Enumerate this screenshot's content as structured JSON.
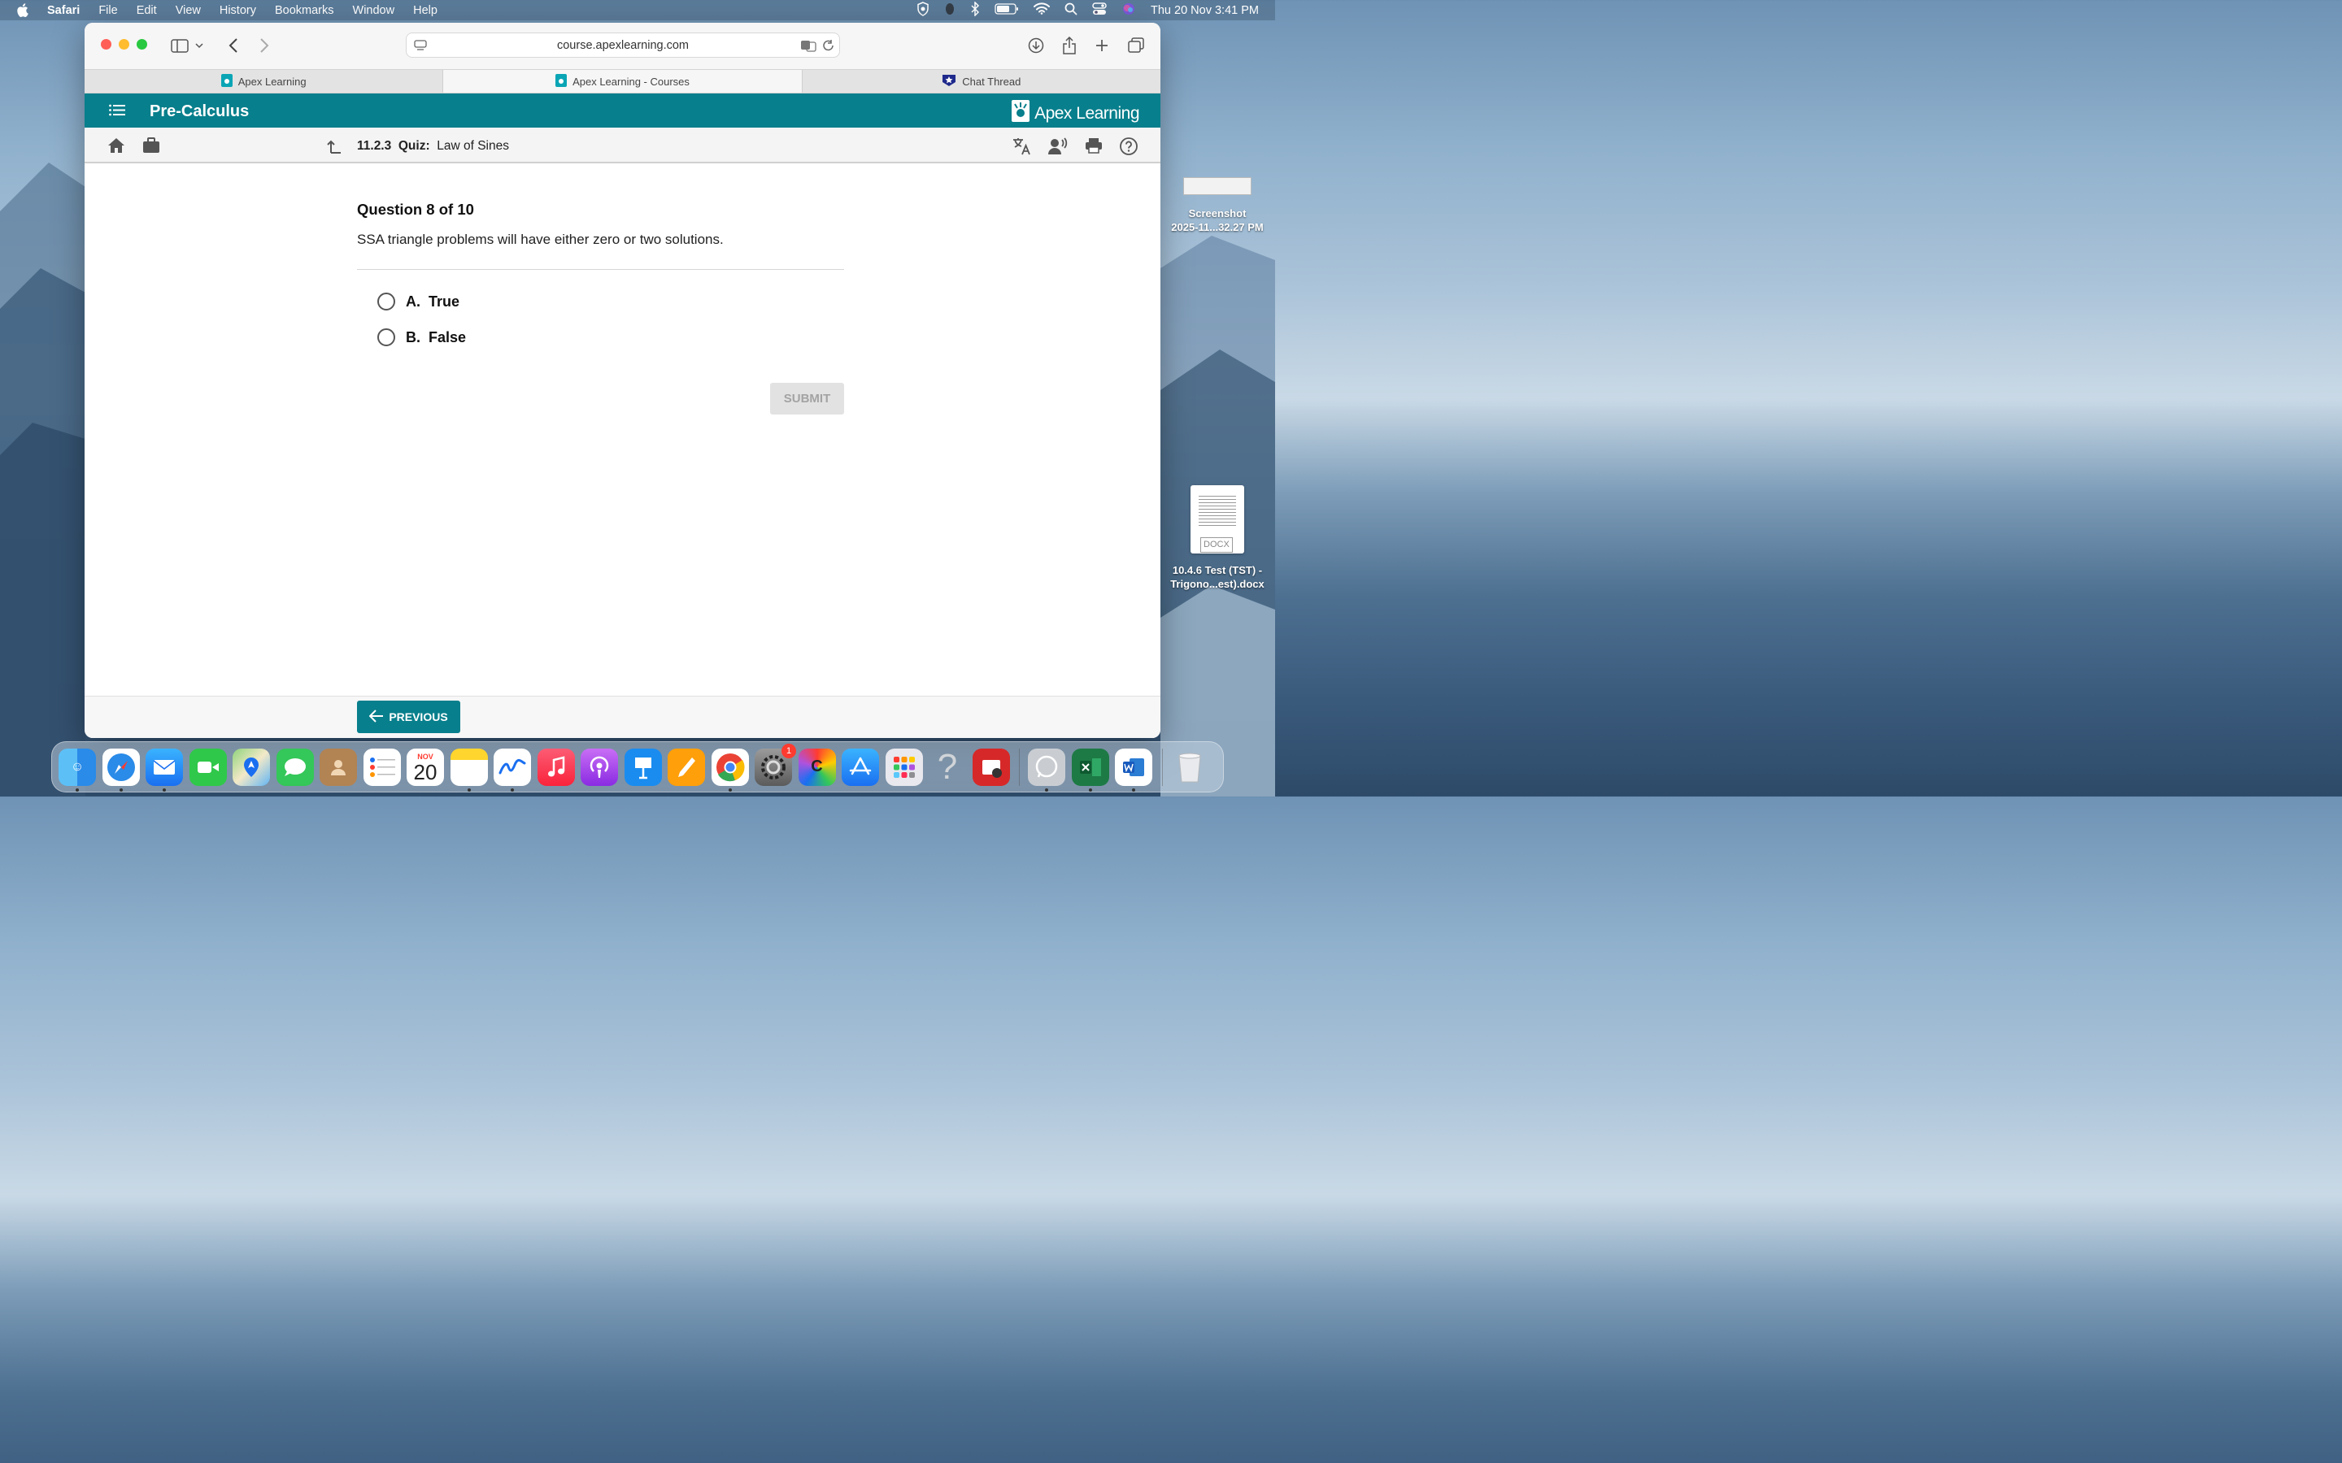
{
  "menubar": {
    "app": "Safari",
    "items": [
      "File",
      "Edit",
      "View",
      "History",
      "Bookmarks",
      "Window",
      "Help"
    ],
    "clock": "Thu 20 Nov  3:41 PM"
  },
  "browser": {
    "url": "course.apexlearning.com",
    "tabs": [
      {
        "label": "Apex Learning",
        "active": false
      },
      {
        "label": "Apex Learning - Courses",
        "active": true
      },
      {
        "label": "Chat Thread",
        "active": false
      }
    ]
  },
  "apex": {
    "course_title": "Pre-Calculus",
    "logo_text": "Apex Learning",
    "breadcrumb": {
      "number": "11.2.3",
      "type": "Quiz:",
      "name": "Law of Sines"
    }
  },
  "question": {
    "heading": "Question 8 of 10",
    "text": "SSA triangle problems will have either zero or two solutions.",
    "options": [
      {
        "letter": "A.",
        "label": "True"
      },
      {
        "letter": "B.",
        "label": "False"
      }
    ],
    "submit_label": "SUBMIT",
    "previous_label": "PREVIOUS"
  },
  "desktop": {
    "files": [
      {
        "name_line1": "Screenshot",
        "name_line2": "2025-11...32.27 PM"
      },
      {
        "name_line1": "10.4.6 Test (TST) -",
        "name_line2": "Trigono...est).docx",
        "badge": "DOCX"
      }
    ]
  },
  "dock": {
    "calendar_month": "NOV",
    "calendar_day": "20",
    "settings_badge": "1"
  },
  "colors": {
    "apex_teal": "#087f8c",
    "submit_disabled_bg": "#e2e2e2"
  }
}
